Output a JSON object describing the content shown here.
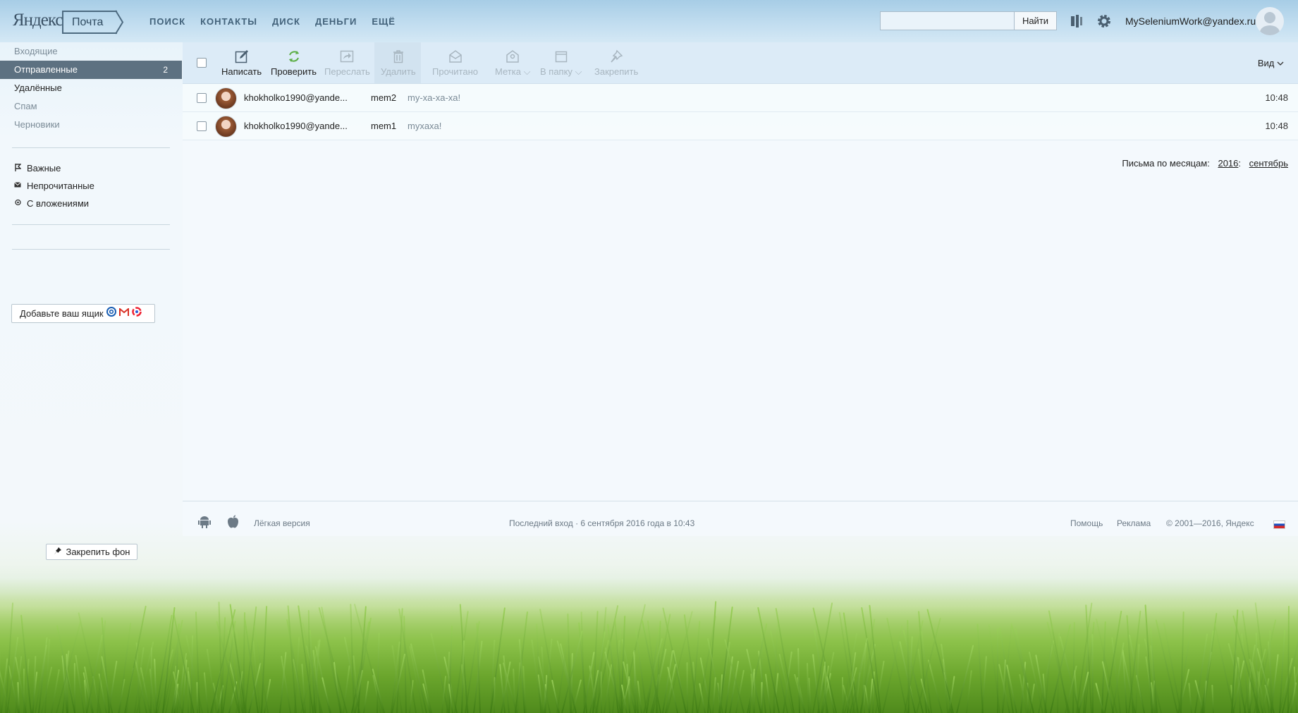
{
  "header": {
    "logo": "Яндекс",
    "service": "Почта",
    "nav": [
      "ПОИСК",
      "КОНТАКТЫ",
      "ДИСК",
      "ДЕНЬГИ",
      "ЕЩЁ"
    ],
    "search_placeholder": "",
    "search_button": "Найти",
    "username": "MySeleniumWork@yandex.ru"
  },
  "sidebar": {
    "folders": [
      {
        "label": "Входящие"
      },
      {
        "label": "Отправленные",
        "count": "2"
      },
      {
        "label": "Удалённые"
      },
      {
        "label": "Спам"
      },
      {
        "label": "Черновики"
      }
    ],
    "filters": [
      {
        "label": "Важные",
        "icon": "flag-icon"
      },
      {
        "label": "Непрочитанные",
        "icon": "envelope-icon"
      },
      {
        "label": "С вложениями",
        "icon": "paperclip-icon"
      }
    ],
    "add_mailbox": "Добавьте ваш ящик",
    "pin_background": "Закрепить фон"
  },
  "toolbar": {
    "compose": "Написать",
    "check": "Проверить",
    "forward": "Переслать",
    "delete": "Удалить",
    "read": "Прочитано",
    "label": "Метка",
    "to_folder": "В папку",
    "pin": "Закрепить",
    "view": "Вид"
  },
  "messages": [
    {
      "from": "khokholko1990@yande...",
      "subject": "mem2",
      "snippet": "my-xa-xa-xa!",
      "time": "10:48"
    },
    {
      "from": "khokholko1990@yande...",
      "subject": "mem1",
      "snippet": "myxaxa!",
      "time": "10:48"
    }
  ],
  "months": {
    "label": "Письма по месяцам:",
    "year": "2016",
    "month": "сентябрь"
  },
  "footer": {
    "light_version": "Лёгкая версия",
    "last_login": "Последний вход · 6 сентября 2016 года в 10:43",
    "help": "Помощь",
    "ads": "Реклама",
    "copyright": "© 2001—2016, Яндекс"
  },
  "colors": {
    "active_folder_bg": "#5d7181",
    "accent": "#42627a"
  }
}
